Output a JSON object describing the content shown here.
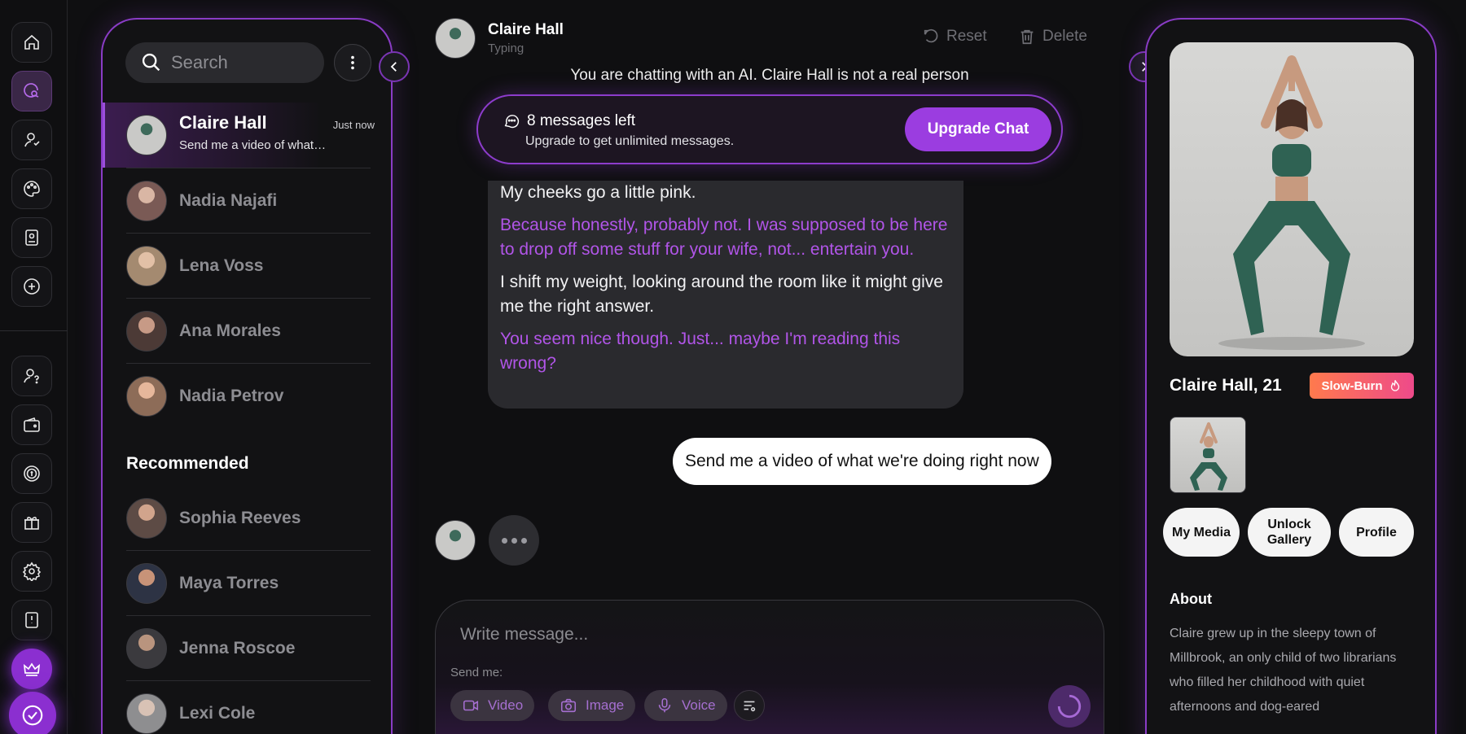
{
  "colors": {
    "accent": "#9b3de0",
    "speech": "#b155e8",
    "bg": "#0f0f11",
    "tag_from": "#ff7a4d",
    "tag_to": "#ee4a8a"
  },
  "rail": {
    "top_icons": [
      "home-icon",
      "chat-search-icon",
      "user-icon",
      "palette-icon",
      "id-card-icon",
      "add-circle-icon"
    ],
    "bottom_icons": [
      "user-question-icon",
      "wallet-icon",
      "coin-icon",
      "gift-icon",
      "settings-icon",
      "book-info-icon",
      "crown-icon",
      "check-badge-icon"
    ]
  },
  "search": {
    "placeholder": "Search"
  },
  "chats": [
    {
      "name": "Claire Hall",
      "time": "Just now",
      "preview": "Send me a video of what…",
      "active": true
    },
    {
      "name": "Nadia Najafi"
    },
    {
      "name": "Lena Voss"
    },
    {
      "name": "Ana Morales"
    },
    {
      "name": "Nadia Petrov"
    }
  ],
  "recommended": {
    "heading": "Recommended",
    "items": [
      {
        "name": "Sophia Reeves"
      },
      {
        "name": "Maya Torres"
      },
      {
        "name": "Jenna Roscoe"
      },
      {
        "name": "Lexi Cole"
      }
    ]
  },
  "conversation": {
    "name": "Claire Hall",
    "status": "Typing",
    "reset_label": "Reset",
    "delete_label": "Delete",
    "ai_notice": "You are chatting with an AI. Claire Hall is not a real person",
    "limit": {
      "count_text": "8 messages left",
      "sub_text": "Upgrade to get unlimited messages.",
      "button": "Upgrade Chat"
    },
    "ai_message": [
      {
        "text": "My cheeks go a little pink.",
        "speech": false
      },
      {
        "text": "Because honestly, probably not. I was supposed to be here to drop off some stuff for your wife, not... entertain you.",
        "speech": true
      },
      {
        "text": "I shift my weight, looking around the room like it might give me the right answer.",
        "speech": false
      },
      {
        "text": "You seem nice though. Just... maybe I'm reading this wrong?",
        "speech": true
      }
    ],
    "user_message": "Send me a video of what we're doing right now"
  },
  "composer": {
    "placeholder": "Write message...",
    "send_me_label": "Send me:",
    "chips": [
      {
        "label": "Video",
        "icon": "video-icon"
      },
      {
        "label": "Image",
        "icon": "camera-icon"
      },
      {
        "label": "Voice",
        "icon": "mic-icon"
      }
    ]
  },
  "profile": {
    "name_age": "Claire Hall, 21",
    "tag": "Slow-Burn",
    "buttons": {
      "media": "My Media",
      "gallery": "Unlock Gallery",
      "profile": "Profile"
    },
    "about_heading": "About",
    "about_text": "Claire grew up in the sleepy town of Millbrook, an only child of two librarians who filled her childhood with quiet afternoons and dog-eared"
  }
}
